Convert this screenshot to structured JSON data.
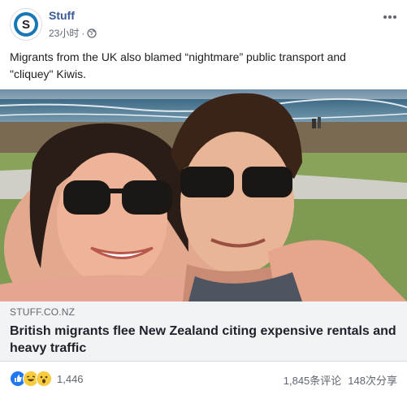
{
  "post": {
    "page_name": "Stuff",
    "time": "23小时",
    "separator": "·",
    "caption": "Migrants from the UK also blamed “nightmare” public transport and \"cliquey\" Kiwis.",
    "avatar_letter": "S",
    "more_icon": "ellipsis-icon",
    "privacy_icon": "globe-icon"
  },
  "link": {
    "domain": "STUFF.CO.NZ",
    "headline": "British migrants flee New Zealand citing expensive rentals and heavy traffic"
  },
  "footer": {
    "reaction_icons": [
      "like-icon",
      "haha-icon",
      "wow-icon"
    ],
    "reaction_count": "1,446",
    "comments": "1,845条评论",
    "shares": "148次分享"
  },
  "colors": {
    "brand_blue": "#385898",
    "avatar_ring": "#1877b5",
    "like": "#2078f4",
    "emoji_yellow": "#f7cc3f"
  }
}
